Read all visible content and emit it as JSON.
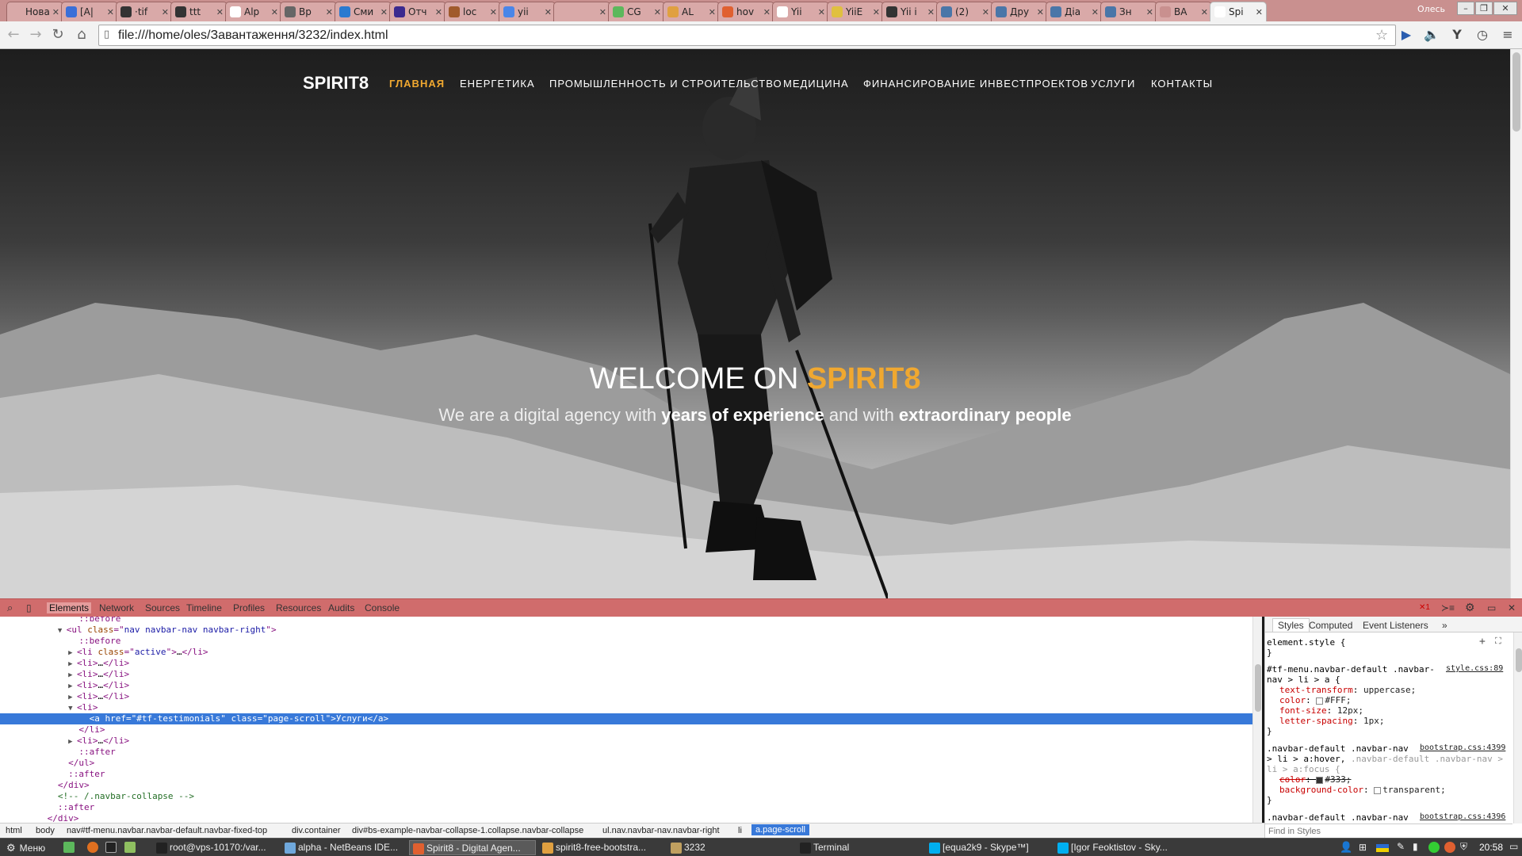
{
  "browser": {
    "tabs": [
      {
        "title": "Нова",
        "color": "#d9a9a8"
      },
      {
        "title": "[A|",
        "color": "#3a6fd8"
      },
      {
        "title": "·tif",
        "color": "#333333"
      },
      {
        "title": "ttt",
        "color": "#333333"
      },
      {
        "title": "Alp",
        "color": "#ffffff"
      },
      {
        "title": "Вр",
        "color": "#666666"
      },
      {
        "title": "Сми",
        "color": "#2a7ad0"
      },
      {
        "title": "Отч",
        "color": "#3b2a8f"
      },
      {
        "title": "loc",
        "color": "#a05a2c"
      },
      {
        "title": "yii",
        "color": "#4a86e8"
      },
      {
        "title": "",
        "color": "#d9a9a8"
      },
      {
        "title": "CG",
        "color": "#5cb85c"
      },
      {
        "title": "AL",
        "color": "#e0a040"
      },
      {
        "title": "hov",
        "color": "#e06030"
      },
      {
        "title": "Yii",
        "color": "#ffffff"
      },
      {
        "title": "YiiE",
        "color": "#e0c040"
      },
      {
        "title": "Yii i",
        "color": "#333333"
      },
      {
        "title": "(2)",
        "color": "#4a76a8"
      },
      {
        "title": "Дру",
        "color": "#4a76a8"
      },
      {
        "title": "Діа",
        "color": "#4a76a8"
      },
      {
        "title": "Зн",
        "color": "#4a76a8"
      },
      {
        "title": "BA",
        "color": "#c9908f"
      },
      {
        "title": "Spi",
        "color": "#ffffff",
        "active": true
      }
    ],
    "profile_name": "Олесь",
    "url": "file:///home/oles/Завантаження/3232/index.html"
  },
  "page": {
    "brand": "SPIRIT8",
    "nav": [
      {
        "label": "ГЛАВНАЯ",
        "active": true
      },
      {
        "label": "ЕНЕРГЕТИКА"
      },
      {
        "label": "ПРОМЫШЛЕННОСТЬ И СТРОИТЕЛЬСТВО"
      },
      {
        "label": "МЕДИЦИНА"
      },
      {
        "label": "ФИНАНСИРОВАНИЕ ИНВЕСТПРОЕКТОВ"
      },
      {
        "label": "УСЛУГИ"
      },
      {
        "label": "КОНТАКТЫ"
      }
    ],
    "hero_title_pre": "WELCOME ON ",
    "hero_title_accent": "SPIRIT8",
    "hero_sub_1": "We are a digital agency with ",
    "hero_sub_b1": "years of experience",
    "hero_sub_2": " and with ",
    "hero_sub_b2": "extraordinary people",
    "accent_color": "#f0a830"
  },
  "devtools": {
    "tabs": [
      "Elements",
      "Network",
      "Sources",
      "Timeline",
      "Profiles",
      "Resources",
      "Audits",
      "Console"
    ],
    "error_count": "1",
    "dom_lines": [
      {
        "indent": 8,
        "arrow": "",
        "text": "::before",
        "kind": "pseudo"
      },
      {
        "indent": 6,
        "arrow": "▼",
        "tag": "ul",
        "attrs": [
          [
            "class",
            "nav navbar-nav navbar-right"
          ]
        ],
        "close": false
      },
      {
        "indent": 8,
        "arrow": "",
        "text": "::before",
        "kind": "pseudo"
      },
      {
        "indent": 8,
        "arrow": "▶",
        "tag": "li",
        "attrs": [
          [
            "class",
            "active"
          ]
        ],
        "inner": "…",
        "close": true
      },
      {
        "indent": 8,
        "arrow": "▶",
        "tag": "li",
        "attrs": [],
        "inner": "…",
        "close": true
      },
      {
        "indent": 8,
        "arrow": "▶",
        "tag": "li",
        "attrs": [],
        "inner": "…",
        "close": true
      },
      {
        "indent": 8,
        "arrow": "▶",
        "tag": "li",
        "attrs": [],
        "inner": "…",
        "close": true
      },
      {
        "indent": 8,
        "arrow": "▶",
        "tag": "li",
        "attrs": [],
        "inner": "…",
        "close": true
      },
      {
        "indent": 8,
        "arrow": "▼",
        "tag": "li",
        "attrs": [],
        "close": false
      },
      {
        "indent": 10,
        "arrow": "",
        "tag": "a",
        "attrs": [
          [
            "href",
            "#tf-testimonials"
          ],
          [
            "class",
            "page-scroll"
          ]
        ],
        "inner": "Услуги",
        "close": true,
        "selected": true
      },
      {
        "indent": 8,
        "arrow": "",
        "text": "</li>",
        "kind": "closetag"
      },
      {
        "indent": 8,
        "arrow": "▶",
        "tag": "li",
        "attrs": [],
        "inner": "…",
        "close": true
      },
      {
        "indent": 8,
        "arrow": "",
        "text": "::after",
        "kind": "pseudo"
      },
      {
        "indent": 6,
        "arrow": "",
        "text": "</ul>",
        "kind": "closetag"
      },
      {
        "indent": 6,
        "arrow": "",
        "text": "::after",
        "kind": "pseudo"
      },
      {
        "indent": 4,
        "arrow": "",
        "text": "</div>",
        "kind": "closetag"
      },
      {
        "indent": 4,
        "arrow": "",
        "text": "<!-- /.navbar-collapse -->",
        "kind": "comment"
      },
      {
        "indent": 4,
        "arrow": "",
        "text": "::after",
        "kind": "pseudo"
      },
      {
        "indent": 2,
        "arrow": "",
        "text": "</div>",
        "kind": "closetag"
      }
    ],
    "breadcrumbs": [
      "html",
      "body",
      "nav#tf-menu.navbar.navbar-default.navbar-fixed-top",
      "div.container",
      "div#bs-example-navbar-collapse-1.collapse.navbar-collapse",
      "ul.nav.navbar-nav.navbar-right",
      "li",
      "a.page-scroll"
    ],
    "styles_tabs": [
      "Styles",
      "Computed",
      "Event Listeners",
      "»"
    ],
    "styles": {
      "element_style": "element.style {",
      "rule1_selector_1": "#tf-menu.navbar-default .navbar-",
      "rule1_selector_2": "nav > li > a {",
      "rule1_source": "style.css:89",
      "rule1_props": [
        {
          "name": "text-transform",
          "value": "uppercase;"
        },
        {
          "name": "color",
          "value": "#FFF;",
          "swatch": "#ffffff"
        },
        {
          "name": "font-size",
          "value": "12px;"
        },
        {
          "name": "letter-spacing",
          "value": "1px;"
        }
      ],
      "rule2_selector_1": ".navbar-default .navbar-nav",
      "rule2_source": "bootstrap.css:4399",
      "rule2_selector_2": "> li > a:hover,",
      "rule2_selector_2b": ".navbar-default .navbar-nav >",
      "rule2_selector_3": "li > a:focus {",
      "rule2_props": [
        {
          "name": "color",
          "value": "#333;",
          "swatch": "#333333",
          "struck": true
        },
        {
          "name": "background-color",
          "value": "transparent;",
          "swatch": "#ffffff"
        }
      ],
      "rule3_selector": ".navbar-default .navbar-nav",
      "rule3_source": "bootstrap.css:4396",
      "find_placeholder": "Find in Styles"
    }
  },
  "taskbar": {
    "menu_label": "Меню",
    "items": [
      {
        "label": "root@vps-10170:/var...",
        "color": "#222222"
      },
      {
        "label": "alpha - NetBeans IDE...",
        "color": "#6fa8dc"
      },
      {
        "label": "Spirit8 - Digital Agen...",
        "color": "#e06030",
        "active": true
      },
      {
        "label": "spirit8-free-bootstra...",
        "color": "#e0a040"
      },
      {
        "label": "3232",
        "color": "#c0a060"
      },
      {
        "label": "Terminal",
        "color": "#222222"
      },
      {
        "label": "[equa2k9 - Skype™]",
        "color": "#00aff0"
      },
      {
        "label": "[Igor Feoktistov - Sky...",
        "color": "#00aff0"
      }
    ],
    "clock": "20:58"
  }
}
